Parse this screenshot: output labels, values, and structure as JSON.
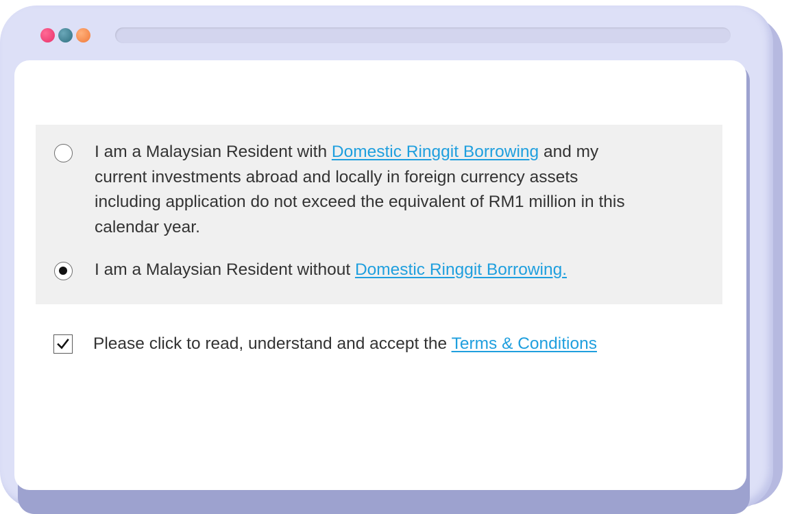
{
  "window": {
    "traffic_lights": [
      {
        "name": "red",
        "color": "#e8316a"
      },
      {
        "name": "teal",
        "color": "#2f6f80"
      },
      {
        "name": "orange",
        "color": "#f07a3a"
      }
    ],
    "frame_color": "#dde0f7"
  },
  "options": [
    {
      "text_before": "I am a Malaysian Resident with ",
      "link": "Domestic Ringgit Borrowing",
      "text_after": " and my current investments abroad and locally in foreign currency assets including application do not exceed the equivalent of RM1 million in this calendar year.",
      "selected": false
    },
    {
      "text_before": "I am a Malaysian Resident without ",
      "link": "Domestic Ringgit Borrowing.",
      "text_after": "",
      "selected": true
    }
  ],
  "terms": {
    "text": "Please click to read, understand and accept the ",
    "link": "Terms & Conditions",
    "checked": true
  },
  "colors": {
    "link": "#1f9fde",
    "text": "#333333",
    "option_background": "#f0f0f0"
  }
}
